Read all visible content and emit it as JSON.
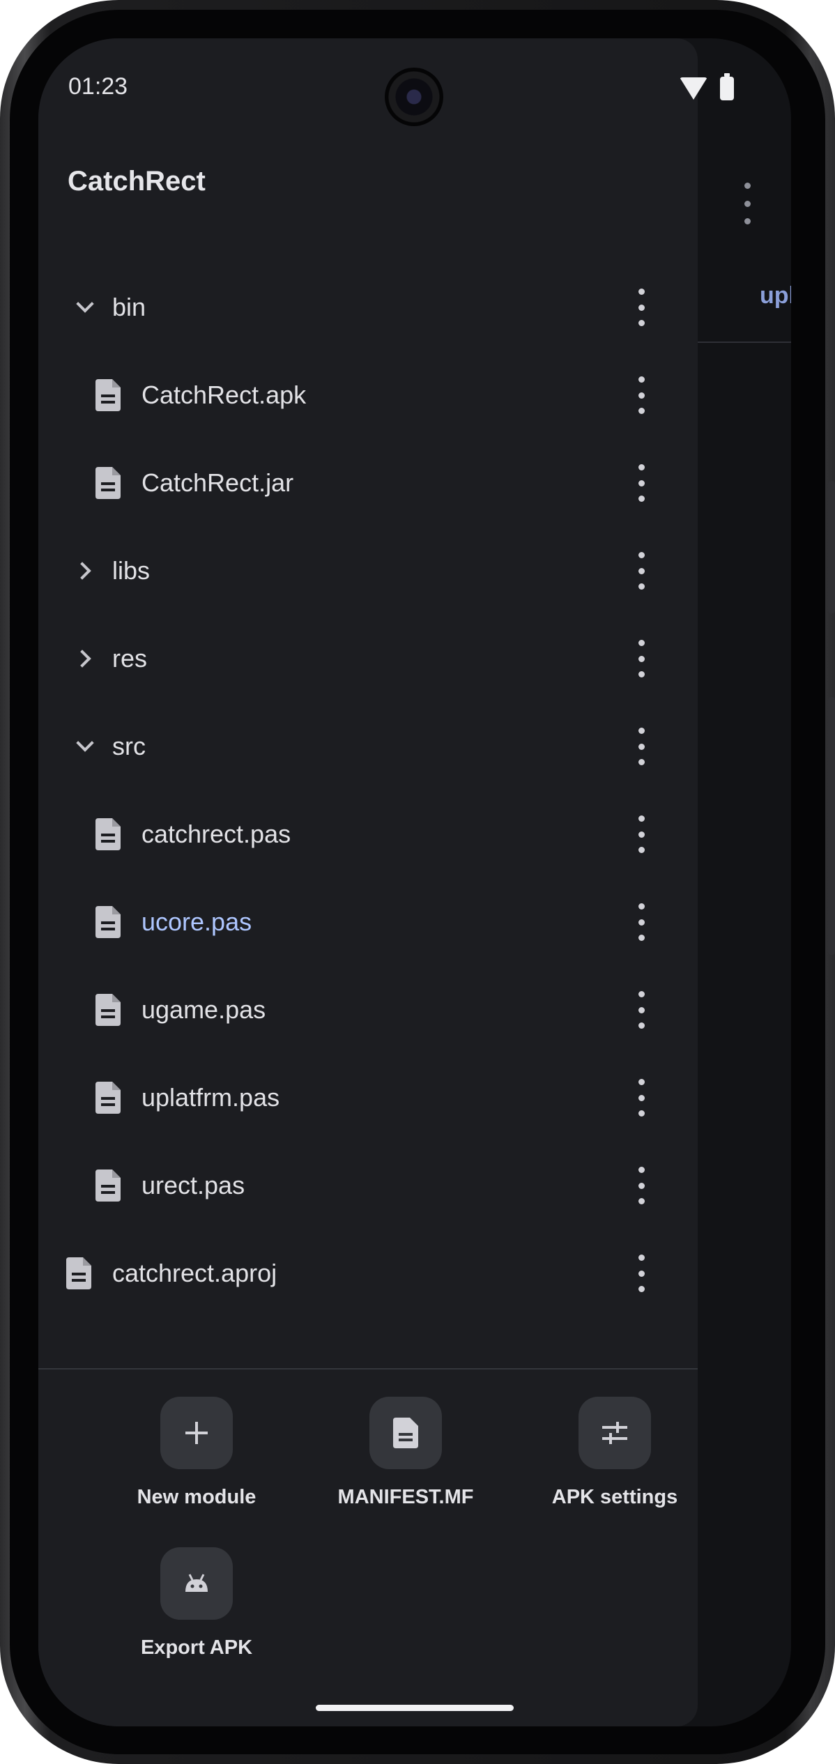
{
  "status_bar": {
    "time": "01:23",
    "icons": [
      "wifi-icon",
      "battery-icon"
    ]
  },
  "background_app": {
    "tab_label": "upl",
    "menu_icon": "more-vertical-icon"
  },
  "drawer": {
    "project_title": "CatchRect",
    "tree": [
      {
        "label": "bin",
        "type": "folder",
        "expanded": true,
        "depth": 0
      },
      {
        "label": "CatchRect.apk",
        "type": "file",
        "depth": 1
      },
      {
        "label": "CatchRect.jar",
        "type": "file",
        "depth": 1
      },
      {
        "label": "libs",
        "type": "folder",
        "expanded": false,
        "depth": 0
      },
      {
        "label": "res",
        "type": "folder",
        "expanded": false,
        "depth": 0
      },
      {
        "label": "src",
        "type": "folder",
        "expanded": true,
        "depth": 0
      },
      {
        "label": "catchrect.pas",
        "type": "file",
        "depth": 1
      },
      {
        "label": "ucore.pas",
        "type": "file",
        "depth": 1,
        "active": true
      },
      {
        "label": "ugame.pas",
        "type": "file",
        "depth": 1
      },
      {
        "label": "uplatfrm.pas",
        "type": "file",
        "depth": 1
      },
      {
        "label": "urect.pas",
        "type": "file",
        "depth": 1
      },
      {
        "label": "catchrect.aproj",
        "type": "file",
        "depth": 0
      }
    ],
    "actions": [
      {
        "label": "New module",
        "icon": "plus-icon"
      },
      {
        "label": "MANIFEST.MF",
        "icon": "document-icon"
      },
      {
        "label": "APK settings",
        "icon": "sliders-icon"
      },
      {
        "label": "Export APK",
        "icon": "android-icon"
      }
    ]
  },
  "colors": {
    "drawer_bg": "#1c1d21",
    "text": "#e2e2e6",
    "active_text": "#aec6ff",
    "icon": "#c6c6cc",
    "action_bg": "#34363b"
  }
}
